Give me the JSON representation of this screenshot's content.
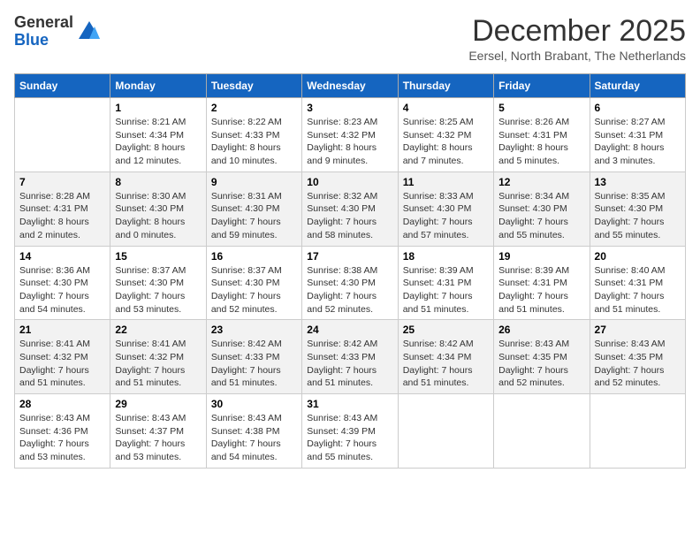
{
  "logo": {
    "general": "General",
    "blue": "Blue"
  },
  "title": "December 2025",
  "subtitle": "Eersel, North Brabant, The Netherlands",
  "days_of_week": [
    "Sunday",
    "Monday",
    "Tuesday",
    "Wednesday",
    "Thursday",
    "Friday",
    "Saturday"
  ],
  "weeks": [
    [
      {
        "day": "",
        "info": ""
      },
      {
        "day": "1",
        "info": "Sunrise: 8:21 AM\nSunset: 4:34 PM\nDaylight: 8 hours and 12 minutes."
      },
      {
        "day": "2",
        "info": "Sunrise: 8:22 AM\nSunset: 4:33 PM\nDaylight: 8 hours and 10 minutes."
      },
      {
        "day": "3",
        "info": "Sunrise: 8:23 AM\nSunset: 4:32 PM\nDaylight: 8 hours and 9 minutes."
      },
      {
        "day": "4",
        "info": "Sunrise: 8:25 AM\nSunset: 4:32 PM\nDaylight: 8 hours and 7 minutes."
      },
      {
        "day": "5",
        "info": "Sunrise: 8:26 AM\nSunset: 4:31 PM\nDaylight: 8 hours and 5 minutes."
      },
      {
        "day": "6",
        "info": "Sunrise: 8:27 AM\nSunset: 4:31 PM\nDaylight: 8 hours and 3 minutes."
      }
    ],
    [
      {
        "day": "7",
        "info": "Sunrise: 8:28 AM\nSunset: 4:31 PM\nDaylight: 8 hours and 2 minutes."
      },
      {
        "day": "8",
        "info": "Sunrise: 8:30 AM\nSunset: 4:30 PM\nDaylight: 8 hours and 0 minutes."
      },
      {
        "day": "9",
        "info": "Sunrise: 8:31 AM\nSunset: 4:30 PM\nDaylight: 7 hours and 59 minutes."
      },
      {
        "day": "10",
        "info": "Sunrise: 8:32 AM\nSunset: 4:30 PM\nDaylight: 7 hours and 58 minutes."
      },
      {
        "day": "11",
        "info": "Sunrise: 8:33 AM\nSunset: 4:30 PM\nDaylight: 7 hours and 57 minutes."
      },
      {
        "day": "12",
        "info": "Sunrise: 8:34 AM\nSunset: 4:30 PM\nDaylight: 7 hours and 55 minutes."
      },
      {
        "day": "13",
        "info": "Sunrise: 8:35 AM\nSunset: 4:30 PM\nDaylight: 7 hours and 55 minutes."
      }
    ],
    [
      {
        "day": "14",
        "info": "Sunrise: 8:36 AM\nSunset: 4:30 PM\nDaylight: 7 hours and 54 minutes."
      },
      {
        "day": "15",
        "info": "Sunrise: 8:37 AM\nSunset: 4:30 PM\nDaylight: 7 hours and 53 minutes."
      },
      {
        "day": "16",
        "info": "Sunrise: 8:37 AM\nSunset: 4:30 PM\nDaylight: 7 hours and 52 minutes."
      },
      {
        "day": "17",
        "info": "Sunrise: 8:38 AM\nSunset: 4:30 PM\nDaylight: 7 hours and 52 minutes."
      },
      {
        "day": "18",
        "info": "Sunrise: 8:39 AM\nSunset: 4:31 PM\nDaylight: 7 hours and 51 minutes."
      },
      {
        "day": "19",
        "info": "Sunrise: 8:39 AM\nSunset: 4:31 PM\nDaylight: 7 hours and 51 minutes."
      },
      {
        "day": "20",
        "info": "Sunrise: 8:40 AM\nSunset: 4:31 PM\nDaylight: 7 hours and 51 minutes."
      }
    ],
    [
      {
        "day": "21",
        "info": "Sunrise: 8:41 AM\nSunset: 4:32 PM\nDaylight: 7 hours and 51 minutes."
      },
      {
        "day": "22",
        "info": "Sunrise: 8:41 AM\nSunset: 4:32 PM\nDaylight: 7 hours and 51 minutes."
      },
      {
        "day": "23",
        "info": "Sunrise: 8:42 AM\nSunset: 4:33 PM\nDaylight: 7 hours and 51 minutes."
      },
      {
        "day": "24",
        "info": "Sunrise: 8:42 AM\nSunset: 4:33 PM\nDaylight: 7 hours and 51 minutes."
      },
      {
        "day": "25",
        "info": "Sunrise: 8:42 AM\nSunset: 4:34 PM\nDaylight: 7 hours and 51 minutes."
      },
      {
        "day": "26",
        "info": "Sunrise: 8:43 AM\nSunset: 4:35 PM\nDaylight: 7 hours and 52 minutes."
      },
      {
        "day": "27",
        "info": "Sunrise: 8:43 AM\nSunset: 4:35 PM\nDaylight: 7 hours and 52 minutes."
      }
    ],
    [
      {
        "day": "28",
        "info": "Sunrise: 8:43 AM\nSunset: 4:36 PM\nDaylight: 7 hours and 53 minutes."
      },
      {
        "day": "29",
        "info": "Sunrise: 8:43 AM\nSunset: 4:37 PM\nDaylight: 7 hours and 53 minutes."
      },
      {
        "day": "30",
        "info": "Sunrise: 8:43 AM\nSunset: 4:38 PM\nDaylight: 7 hours and 54 minutes."
      },
      {
        "day": "31",
        "info": "Sunrise: 8:43 AM\nSunset: 4:39 PM\nDaylight: 7 hours and 55 minutes."
      },
      {
        "day": "",
        "info": ""
      },
      {
        "day": "",
        "info": ""
      },
      {
        "day": "",
        "info": ""
      }
    ]
  ]
}
